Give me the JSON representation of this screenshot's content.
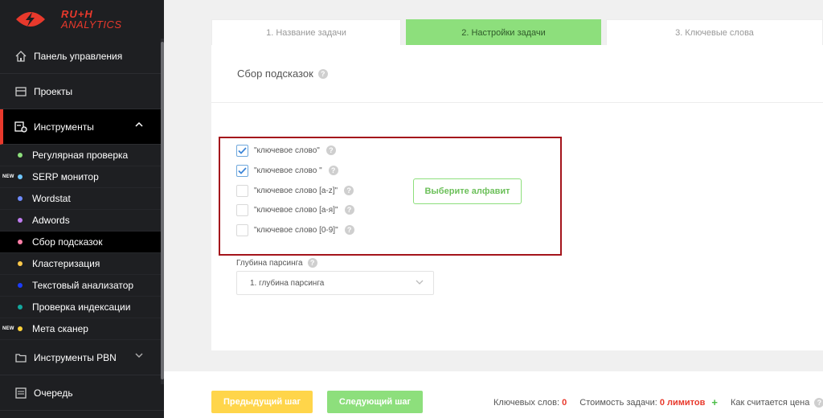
{
  "brand": {
    "line1": "RU+H",
    "line2": "ANALYTICS",
    "accent": "#e8392c"
  },
  "sidebar": {
    "items": [
      {
        "label": "Панель управления",
        "icon": "home-icon"
      },
      {
        "label": "Проекты",
        "icon": "folder-icon"
      },
      {
        "label": "Инструменты",
        "icon": "tools-icon"
      }
    ],
    "tools": [
      {
        "label": "Регулярная проверка",
        "color": "#8ddf7c",
        "new": false
      },
      {
        "label": "SERP монитор",
        "color": "#6fc7ff",
        "new": true
      },
      {
        "label": "Wordstat",
        "color": "#6e8bff",
        "new": false
      },
      {
        "label": "Adwords",
        "color": "#c07cf0",
        "new": false
      },
      {
        "label": "Сбор подсказок",
        "color": "#ff7fa8",
        "new": false
      },
      {
        "label": "Кластеризация",
        "color": "#ffc94a",
        "new": false
      },
      {
        "label": "Текстовый анализатор",
        "color": "#1b3cff",
        "new": false
      },
      {
        "label": "Проверка индексации",
        "color": "#13a89e",
        "new": false
      },
      {
        "label": "Мета сканер",
        "color": "#ffd23a",
        "new": true
      }
    ],
    "new_tag": "NEW",
    "pbn": {
      "label": "Инструменты PBN"
    },
    "queue": {
      "label": "Очередь"
    }
  },
  "tabs": [
    "1. Название задачи",
    "2. Настройки задачи",
    "3. Ключевые слова"
  ],
  "panel": {
    "title": "Сбор подсказок",
    "options": [
      {
        "label": "\"ключевое слово\"",
        "checked": true
      },
      {
        "label": "\"ключевое слово \"",
        "checked": true
      },
      {
        "label": "\"ключевое слово [a-z]\"",
        "checked": false
      },
      {
        "label": "\"ключевое слово [а-я]\"",
        "checked": false
      },
      {
        "label": "\"ключевое слово [0-9]\"",
        "checked": false
      }
    ],
    "alphabet_button": "Выберите алфавит",
    "depth_label": "Глубина парсинга",
    "depth_value": "1. глубина парсинга"
  },
  "footer": {
    "prev": "Предыдущий шаг",
    "next": "Следующий шаг",
    "keywords_label": "Ключевых слов:",
    "keywords_value": "0",
    "cost_label": "Стоимость задачи:",
    "cost_value": "0 лимитов",
    "plus": "+",
    "how_label": "Как считается цена"
  },
  "help_glyph": "?"
}
